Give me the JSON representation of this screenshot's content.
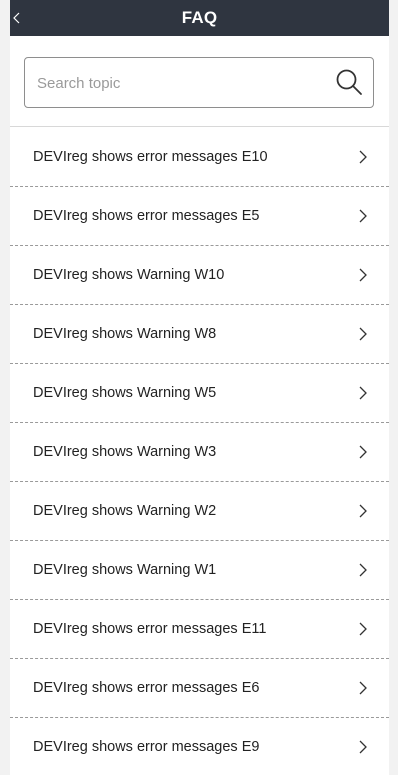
{
  "header": {
    "title": "FAQ",
    "back_icon": "chevron-left-icon"
  },
  "search": {
    "placeholder": "Search topic",
    "value": "",
    "icon": "search-icon"
  },
  "faq": {
    "items": [
      {
        "label": "DEVIreg shows error messages E10"
      },
      {
        "label": "DEVIreg shows error messages E5"
      },
      {
        "label": "DEVIreg shows Warning W10"
      },
      {
        "label": "DEVIreg shows Warning W8"
      },
      {
        "label": "DEVIreg shows Warning W5"
      },
      {
        "label": "DEVIreg shows Warning W3"
      },
      {
        "label": "DEVIreg shows Warning W2"
      },
      {
        "label": "DEVIreg shows Warning W1"
      },
      {
        "label": "DEVIreg shows error messages E11"
      },
      {
        "label": "DEVIreg shows error messages E6"
      },
      {
        "label": "DEVIreg shows error messages E9"
      }
    ],
    "item_icon": "chevron-right-icon"
  },
  "colors": {
    "navbar": "#2f3540",
    "text": "#222222",
    "divider": "#9a9a9a"
  }
}
